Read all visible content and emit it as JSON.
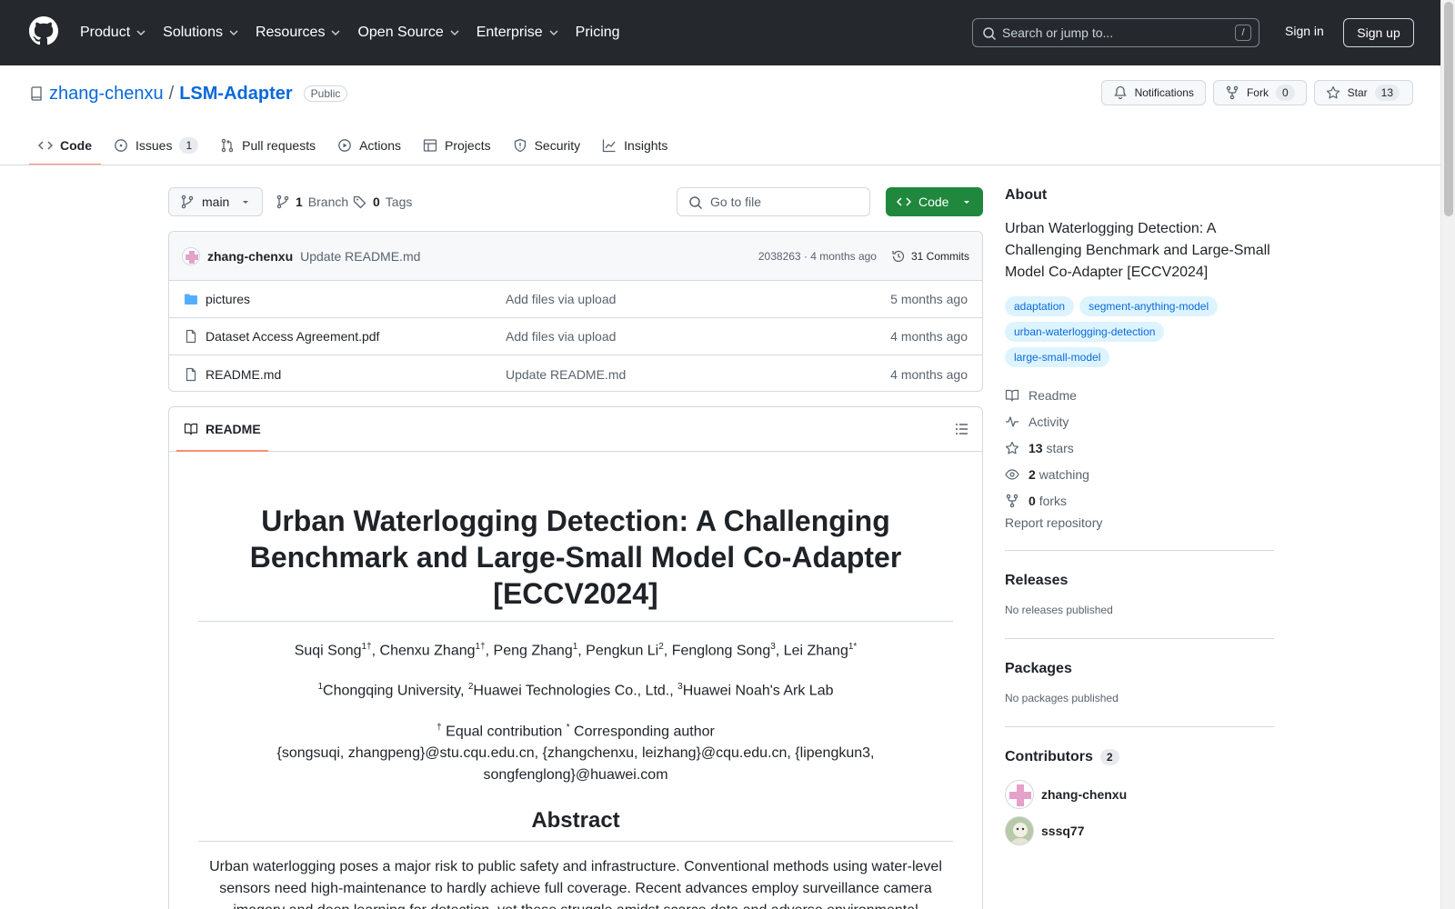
{
  "header": {
    "nav": [
      "Product",
      "Solutions",
      "Resources",
      "Open Source",
      "Enterprise",
      "Pricing"
    ],
    "search_placeholder": "Search or jump to...",
    "search_shortcut": "/",
    "sign_in": "Sign in",
    "sign_up": "Sign up"
  },
  "repo": {
    "owner": "zhang-chenxu",
    "separator": "/",
    "name": "LSM-Adapter",
    "visibility": "Public",
    "notifications": "Notifications",
    "fork_label": "Fork",
    "fork_count": "0",
    "star_label": "Star",
    "star_count": "13"
  },
  "tabs": [
    {
      "label": "Code"
    },
    {
      "label": "Issues",
      "count": "1"
    },
    {
      "label": "Pull requests"
    },
    {
      "label": "Actions"
    },
    {
      "label": "Projects"
    },
    {
      "label": "Security"
    },
    {
      "label": "Insights"
    }
  ],
  "toolbar": {
    "branch": "main",
    "branch_count": "1",
    "branch_label": "Branch",
    "tag_count": "0",
    "tag_label": "Tags",
    "goto_file": "Go to file",
    "code_button": "Code"
  },
  "commit": {
    "author": "zhang-chenxu",
    "message": "Update README.md",
    "hash_time": "2038263 · 4 months ago",
    "commits": "31 Commits"
  },
  "files": [
    {
      "name": "pictures",
      "type": "folder",
      "message": "Add files via upload",
      "date": "5 months ago"
    },
    {
      "name": "Dataset Access Agreement.pdf",
      "type": "file",
      "message": "Add files via upload",
      "date": "4 months ago"
    },
    {
      "name": "README.md",
      "type": "file",
      "message": "Update README.md",
      "date": "4 months ago"
    }
  ],
  "readme": {
    "tab": "README",
    "title": "Urban Waterlogging Detection: A Challenging Benchmark and Large-Small Model Co-Adapter [ECCV2024]",
    "abstract_heading": "Abstract",
    "abstract": "Urban waterlogging poses a major risk to public safety and infrastructure. Conventional methods using water-level sensors need high-maintenance to hardly achieve full coverage. Recent advances employ surveillance camera imagery and deep learning for detection, yet these struggle amidst scarce data and adverse environmental",
    "emails": "{songsuqi, zhangpeng}@stu.cqu.edu.cn, {zhangchenxu, leizhang}@cqu.edu.cn, {lipengkun3, songfenglong}@huawei.com"
  },
  "about": {
    "heading": "About",
    "description": "Urban Waterlogging Detection: A Challenging Benchmark and Large-Small Model Co-Adapter [ECCV2024]",
    "topics": [
      "adaptation",
      "segment-anything-model",
      "urban-waterlogging-detection",
      "large-small-model"
    ],
    "readme": "Readme",
    "activity": "Activity",
    "stars_count": "13",
    "stars_label": "stars",
    "watching_count": "2",
    "watching_label": "watching",
    "forks_count": "0",
    "forks_label": "forks",
    "report": "Report repository"
  },
  "releases": {
    "heading": "Releases",
    "empty": "No releases published"
  },
  "packages": {
    "heading": "Packages",
    "empty": "No packages published"
  },
  "contributors": {
    "heading": "Contributors",
    "count": "2",
    "list": [
      "zhang-chenxu",
      "sssq77"
    ]
  },
  "colors": {
    "header_bg": "#25292e",
    "link": "#0969da",
    "code_button": "#1f883d",
    "active_tab": "#fd8c73",
    "topic_bg": "#ddf4ff"
  }
}
